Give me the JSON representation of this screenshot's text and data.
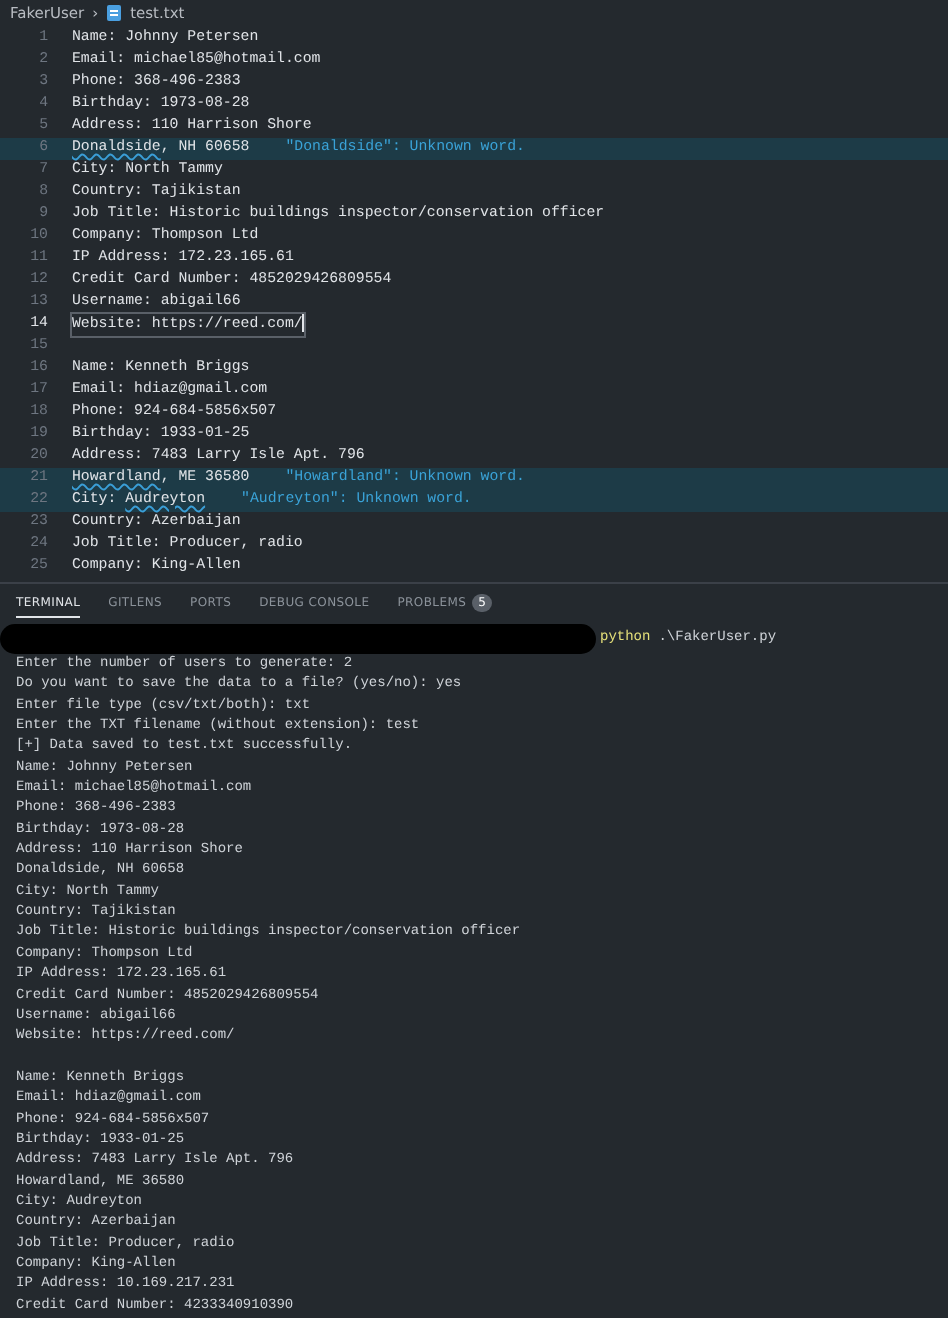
{
  "breadcrumb": {
    "folder": "FakerUser",
    "separator": "›",
    "file": "test.txt"
  },
  "editor": {
    "lines": [
      {
        "number": "1",
        "text": "Name: Johnny Petersen",
        "current": false
      },
      {
        "number": "2",
        "text": "Email: michael85@hotmail.com",
        "current": false
      },
      {
        "number": "3",
        "text": "Phone: 368-496-2383",
        "current": false
      },
      {
        "number": "4",
        "text": "Birthday: 1973-08-28",
        "current": false
      },
      {
        "number": "5",
        "text": "Address: 110 Harrison Shore",
        "current": false
      },
      {
        "number": "6",
        "flagged": "Donaldside",
        "after": ", NH 60658",
        "diagnostic": "\"Donaldside\": Unknown word.",
        "current": false
      },
      {
        "number": "7",
        "text": "City: North Tammy",
        "current": false
      },
      {
        "number": "8",
        "text": "Country: Tajikistan",
        "current": false
      },
      {
        "number": "9",
        "text": "Job Title: Historic buildings inspector/conservation officer",
        "current": false
      },
      {
        "number": "10",
        "text": "Company: Thompson Ltd",
        "current": false
      },
      {
        "number": "11",
        "text": "IP Address: 172.23.165.61",
        "current": false
      },
      {
        "number": "12",
        "text": "Credit Card Number: 4852029426809554",
        "current": false
      },
      {
        "number": "13",
        "text": "Username: abigail66",
        "current": false
      },
      {
        "number": "14",
        "text": "Website: https://reed.com/",
        "current": true
      },
      {
        "number": "15",
        "current": false
      },
      {
        "number": "16",
        "text": "Name: Kenneth Briggs",
        "current": false
      },
      {
        "number": "17",
        "text": "Email: hdiaz@gmail.com",
        "current": false
      },
      {
        "number": "18",
        "text": "Phone: 924-684-5856x507",
        "current": false
      },
      {
        "number": "19",
        "text": "Birthday: 1933-01-25",
        "current": false
      },
      {
        "number": "20",
        "text": "Address: 7483 Larry Isle Apt. 796",
        "current": false
      },
      {
        "number": "21",
        "flagged": "Howardland",
        "after": ", ME 36580",
        "diagnostic": "\"Howardland\": Unknown word.",
        "current": false
      },
      {
        "number": "22",
        "text": "City: ",
        "flagged": "Audreyton",
        "diagnostic": "\"Audreyton\": Unknown word.",
        "current": false
      },
      {
        "number": "23",
        "text": "Country: Azerbaijan",
        "current": false
      },
      {
        "number": "24",
        "text": "Job Title: Producer, radio",
        "current": false
      },
      {
        "number": "25",
        "text": "Company: King-Allen",
        "current": false
      }
    ]
  },
  "panel": {
    "tabs": [
      {
        "label": "TERMINAL",
        "selected": true
      },
      {
        "label": "GITLENS",
        "selected": false
      },
      {
        "label": "PORTS",
        "selected": false
      },
      {
        "label": "DEBUG CONSOLE",
        "selected": false
      },
      {
        "label": "PROBLEMS",
        "badge": "5",
        "selected": false
      }
    ],
    "terminal": {
      "prompt": {
        "redacted": true,
        "command": "python",
        "args": ".\\FakerUser.py"
      },
      "blocks": [
        [
          "Enter the number of users to generate: 2",
          "Do you want to save the data to a file? (yes/no): yes",
          "Enter file type (csv/txt/both): txt",
          "Enter the TXT filename (without extension): test",
          "[+] Data saved to test.txt successfully.",
          "Name: Johnny Petersen",
          "Email: michael85@hotmail.com",
          "Phone: 368-496-2383",
          "Birthday: 1973-08-28",
          "Address: 110 Harrison Shore",
          "Donaldside, NH 60658",
          "City: North Tammy",
          "Country: Tajikistan",
          "Job Title: Historic buildings inspector/conservation officer",
          "Company: Thompson Ltd",
          "IP Address: 172.23.165.61",
          "Credit Card Number: 4852029426809554",
          "Username: abigail66",
          "Website: https://reed.com/"
        ],
        [
          "Name: Kenneth Briggs",
          "Email: hdiaz@gmail.com",
          "Phone: 924-684-5856x507",
          "Birthday: 1933-01-25",
          "Address: 7483 Larry Isle Apt. 796",
          "Howardland, ME 36580",
          "City: Audreyton",
          "Country: Azerbaijan",
          "Job Title: Producer, radio",
          "Company: King-Allen",
          "IP Address: 10.169.217.231",
          "Credit Card Number: 4233340910390"
        ]
      ]
    }
  }
}
